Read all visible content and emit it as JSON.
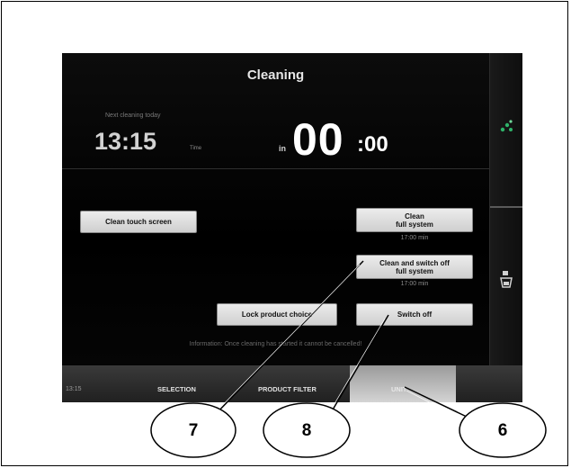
{
  "screen": {
    "title": "Cleaning",
    "next_label": "Next cleaning today",
    "next_time": "13:15",
    "time_unit": "Time",
    "in_label": "in",
    "countdown_big": "00",
    "countdown_small": ":00",
    "info_text": "Information: Once cleaning has started it cannot be cancelled!"
  },
  "buttons": {
    "clean_touch": "Clean touch screen",
    "clean_line1": "Clean",
    "clean_line2": "full system",
    "clean_duration": "17:00 min",
    "clean_off_line1": "Clean and switch off",
    "clean_off_line2": "full system",
    "clean_off_duration": "17:00 min",
    "lock_product": "Lock product choice",
    "switch_off": "Switch off"
  },
  "bottom_bar": {
    "clock": "13:15",
    "tabs": [
      "SELECTION",
      "PRODUCT FILTER",
      "UNIT"
    ],
    "active_tab": "UNIT"
  },
  "side_panel": {
    "top_icon": "drops-icon",
    "bottom_icon": "cup-icon"
  },
  "callouts": [
    "7",
    "8",
    "6"
  ],
  "colors": {
    "screen_bg": "#000000",
    "button_bg": "#e0e0e0",
    "active_tab_bg": "#c8c8c8",
    "accent_green": "#2fb36a"
  }
}
